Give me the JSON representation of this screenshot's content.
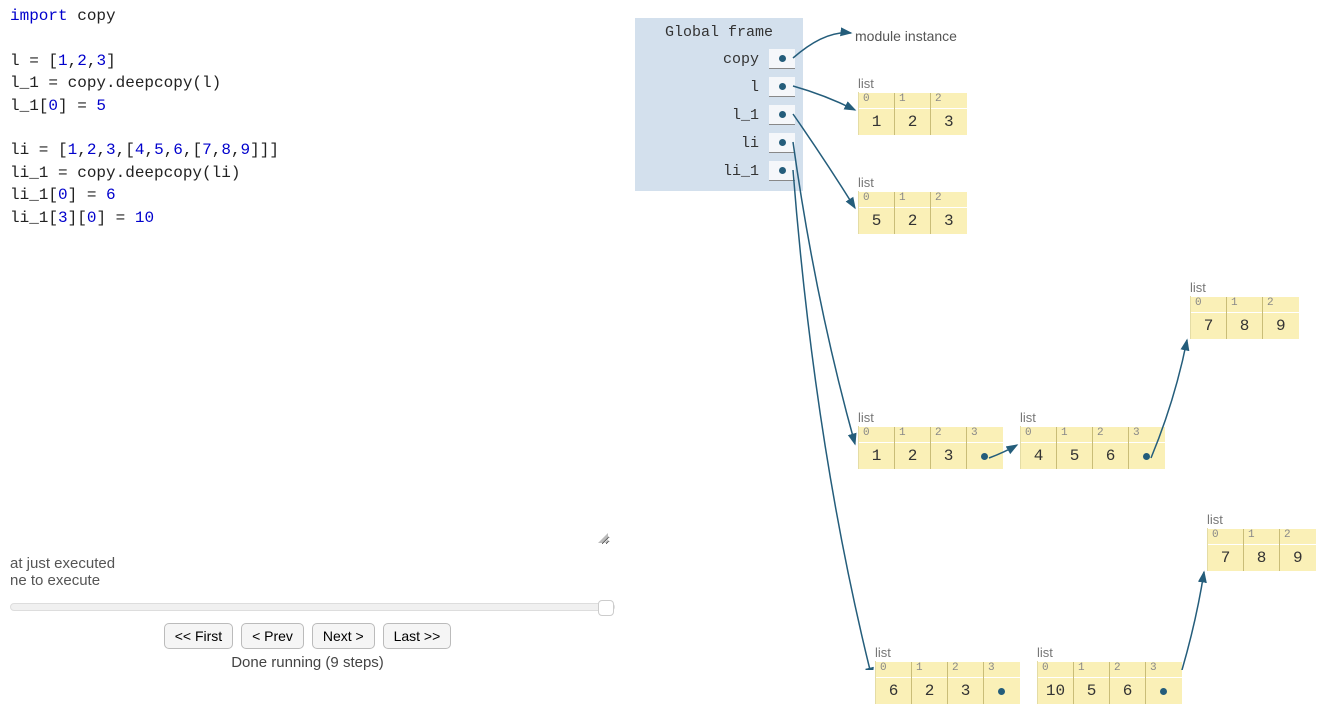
{
  "code": {
    "lines": [
      [
        [
          "kw",
          "import"
        ],
        [
          "txt",
          " copy"
        ]
      ],
      [],
      [
        [
          "txt",
          "l = ["
        ],
        [
          "num",
          "1"
        ],
        [
          "txt",
          ","
        ],
        [
          "num",
          "2"
        ],
        [
          "txt",
          ","
        ],
        [
          "num",
          "3"
        ],
        [
          "txt",
          "]"
        ]
      ],
      [
        [
          "txt",
          "l_1 = copy.deepcopy(l)"
        ]
      ],
      [
        [
          "txt",
          "l_1["
        ],
        [
          "num",
          "0"
        ],
        [
          "txt",
          "] = "
        ],
        [
          "num",
          "5"
        ]
      ],
      [],
      [
        [
          "txt",
          "li = ["
        ],
        [
          "num",
          "1"
        ],
        [
          "txt",
          ","
        ],
        [
          "num",
          "2"
        ],
        [
          "txt",
          ","
        ],
        [
          "num",
          "3"
        ],
        [
          "txt",
          ",["
        ],
        [
          "num",
          "4"
        ],
        [
          "txt",
          ","
        ],
        [
          "num",
          "5"
        ],
        [
          "txt",
          ","
        ],
        [
          "num",
          "6"
        ],
        [
          "txt",
          ",["
        ],
        [
          "num",
          "7"
        ],
        [
          "txt",
          ","
        ],
        [
          "num",
          "8"
        ],
        [
          "txt",
          ","
        ],
        [
          "num",
          "9"
        ],
        [
          "txt",
          "]]]"
        ]
      ],
      [
        [
          "txt",
          "li_1 = copy.deepcopy(li)"
        ]
      ],
      [
        [
          "txt",
          "li_1["
        ],
        [
          "num",
          "0"
        ],
        [
          "txt",
          "] = "
        ],
        [
          "num",
          "6"
        ]
      ],
      [
        [
          "txt",
          "li_1["
        ],
        [
          "num",
          "3"
        ],
        [
          "txt",
          "]["
        ],
        [
          "num",
          "0"
        ],
        [
          "txt",
          "] = "
        ],
        [
          "num",
          "10"
        ]
      ]
    ]
  },
  "status": {
    "line1": "at just executed",
    "line2": "ne to execute"
  },
  "buttons": {
    "first": "<< First",
    "prev": "< Prev",
    "next": "Next >",
    "last": "Last >>"
  },
  "finalMsg": "Done running (9 steps)",
  "frame": {
    "title": "Global frame",
    "vars": [
      "copy",
      "l",
      "l_1",
      "li",
      "li_1"
    ]
  },
  "moduleText": "module instance",
  "listLabel": "list",
  "heap": {
    "list_l": {
      "indices": [
        "0",
        "1",
        "2"
      ],
      "values": [
        "1",
        "2",
        "3"
      ]
    },
    "list_l1": {
      "indices": [
        "0",
        "1",
        "2"
      ],
      "values": [
        "5",
        "2",
        "3"
      ]
    },
    "list_li": {
      "indices": [
        "0",
        "1",
        "2",
        "3"
      ],
      "values": [
        "1",
        "2",
        "3",
        ""
      ]
    },
    "list_li_inner": {
      "indices": [
        "0",
        "1",
        "2",
        "3"
      ],
      "values": [
        "4",
        "5",
        "6",
        ""
      ]
    },
    "list_li_inner2": {
      "indices": [
        "0",
        "1",
        "2"
      ],
      "values": [
        "7",
        "8",
        "9"
      ]
    },
    "list_li1": {
      "indices": [
        "0",
        "1",
        "2",
        "3"
      ],
      "values": [
        "6",
        "2",
        "3",
        ""
      ]
    },
    "list_li1_inner": {
      "indices": [
        "0",
        "1",
        "2",
        "3"
      ],
      "values": [
        "10",
        "5",
        "6",
        ""
      ]
    },
    "list_li1_inner2": {
      "indices": [
        "0",
        "1",
        "2"
      ],
      "values": [
        "7",
        "8",
        "9"
      ]
    }
  }
}
